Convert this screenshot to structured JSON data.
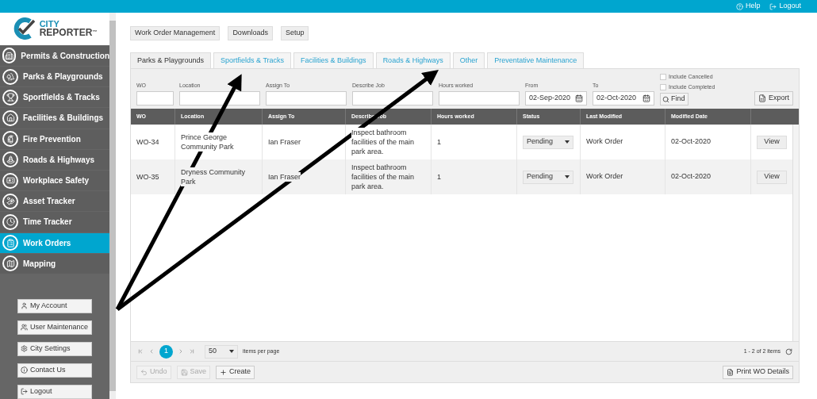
{
  "top_bar": {
    "links": [
      {
        "label": "Help",
        "kind": "help"
      },
      {
        "label": "Logout",
        "kind": "logout"
      }
    ]
  },
  "logo": {
    "line1": "CITY",
    "line2": "REPORTER",
    "mark": "™"
  },
  "sidebar": {
    "items": [
      {
        "label": "Permits & Construction",
        "selected": false
      },
      {
        "label": "Parks & Playgrounds",
        "selected": false
      },
      {
        "label": "Sportfields & Tracks",
        "selected": false
      },
      {
        "label": "Facilities & Buildings",
        "selected": false
      },
      {
        "label": "Fire Prevention",
        "selected": false
      },
      {
        "label": "Roads & Highways",
        "selected": false
      },
      {
        "label": "Workplace Safety",
        "selected": false
      },
      {
        "label": "Asset Tracker",
        "selected": false
      },
      {
        "label": "Time Tracker",
        "selected": false
      },
      {
        "label": "Work Orders",
        "selected": true
      },
      {
        "label": "Mapping",
        "selected": false
      }
    ],
    "buttons": [
      {
        "label": "My Account",
        "kind": "user"
      },
      {
        "label": "User Maintenance",
        "kind": "users"
      },
      {
        "label": "City Settings",
        "kind": "gear"
      },
      {
        "label": "Contact Us",
        "kind": "info"
      },
      {
        "label": "Logout",
        "kind": "logout"
      }
    ]
  },
  "toolbar": [
    "Work Order Management",
    "Downloads",
    "Setup"
  ],
  "tabs": [
    {
      "label": "Parks & Playgrounds",
      "selected": true
    },
    {
      "label": "Sportfields & Tracks",
      "selected": false
    },
    {
      "label": "Facilities & Buildings",
      "selected": false
    },
    {
      "label": "Roads & Highways",
      "selected": false
    },
    {
      "label": "Other",
      "selected": false
    },
    {
      "label": "Preventative Maintenance",
      "selected": false
    }
  ],
  "filters": {
    "fields": [
      {
        "label": "WO",
        "kind": "text"
      },
      {
        "label": "Location",
        "kind": "text"
      },
      {
        "label": "Assign To",
        "kind": "text"
      },
      {
        "label": "Describe Job",
        "kind": "text"
      },
      {
        "label": "Hours worked",
        "kind": "text"
      },
      {
        "label": "From",
        "kind": "date",
        "value": "02-Sep-2020"
      },
      {
        "label": "To",
        "kind": "date",
        "value": "02-Oct-2020"
      }
    ],
    "checkboxes": [
      {
        "label": "Include Cancelled",
        "checked": false
      },
      {
        "label": "Include Completed",
        "checked": false
      }
    ],
    "find": "Find",
    "export": "Export"
  },
  "table": {
    "columns": [
      "WO",
      "Location",
      "Assign To",
      "Describe Job",
      "Hours worked",
      "Status",
      "Last Modified",
      "Modified Date"
    ],
    "rows": [
      {
        "wo": "WO-34",
        "location": "Prince George Community Park",
        "assign_to": "Ian Fraser",
        "describe_job": "Inspect bathroom facilities of the main park area.",
        "hours": "1",
        "status": "Pending",
        "last_modified": "Work Order",
        "modified_date": "02-Oct-2020",
        "action": "View"
      },
      {
        "wo": "WO-35",
        "location": "Dryness Community Park",
        "assign_to": "Ian Fraser",
        "describe_job": "Inspect bathroom facilities of the main park area.",
        "hours": "1",
        "status": "Pending",
        "last_modified": "Work Order",
        "modified_date": "02-Oct-2020",
        "action": "View"
      }
    ]
  },
  "pager": {
    "pages": [
      {
        "label": "1",
        "selected": true
      }
    ],
    "page_size": "50",
    "page_size_label": "items per page",
    "summary": "1 - 2 of 2 items"
  },
  "actions": [
    {
      "label": "Undo",
      "kind": "undo",
      "disabled": true
    },
    {
      "label": "Save",
      "kind": "save",
      "disabled": true
    },
    {
      "label": "Create",
      "kind": "create",
      "disabled": false
    }
  ],
  "print": "Print WO Details"
}
